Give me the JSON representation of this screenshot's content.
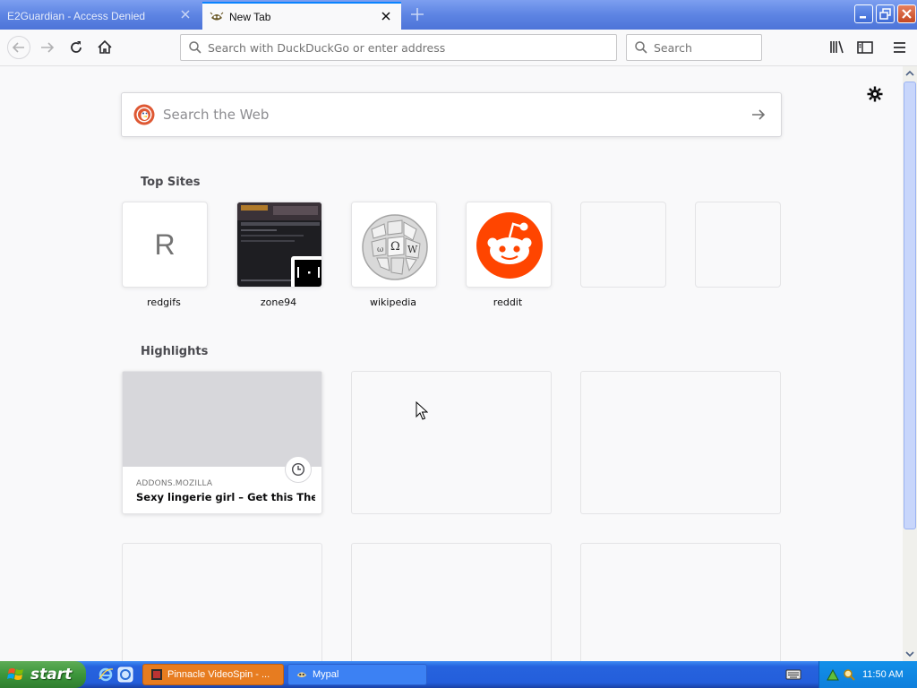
{
  "tabs": [
    {
      "label": "E2Guardian - Access Denied",
      "active": false
    },
    {
      "label": "New Tab",
      "active": true
    }
  ],
  "toolbar": {
    "url_placeholder": "Search with DuckDuckGo or enter address",
    "search_placeholder": "Search"
  },
  "newtab": {
    "web_search_placeholder": "Search the Web",
    "top_sites_title": "Top Sites",
    "highlights_title": "Highlights",
    "top_sites": [
      {
        "label": "redgifs",
        "letter": "R"
      },
      {
        "label": "zone94"
      },
      {
        "label": "wikipedia"
      },
      {
        "label": "reddit"
      }
    ],
    "highlights": [
      {
        "host": "ADDONS.MOZILLA",
        "title": "Sexy lingerie girl – Get this The..."
      }
    ]
  },
  "taskbar": {
    "start_label": "start",
    "tasks": [
      {
        "label": "Pinnacle VideoSpin - ..."
      },
      {
        "label": "Mypal"
      }
    ],
    "clock": "11:50 AM"
  },
  "colors": {
    "accent": "#0a84ff",
    "reddit": "#ff4500",
    "ddg": "#de5833",
    "xp_blue": "#245edb",
    "xp_green": "#3c963b"
  }
}
